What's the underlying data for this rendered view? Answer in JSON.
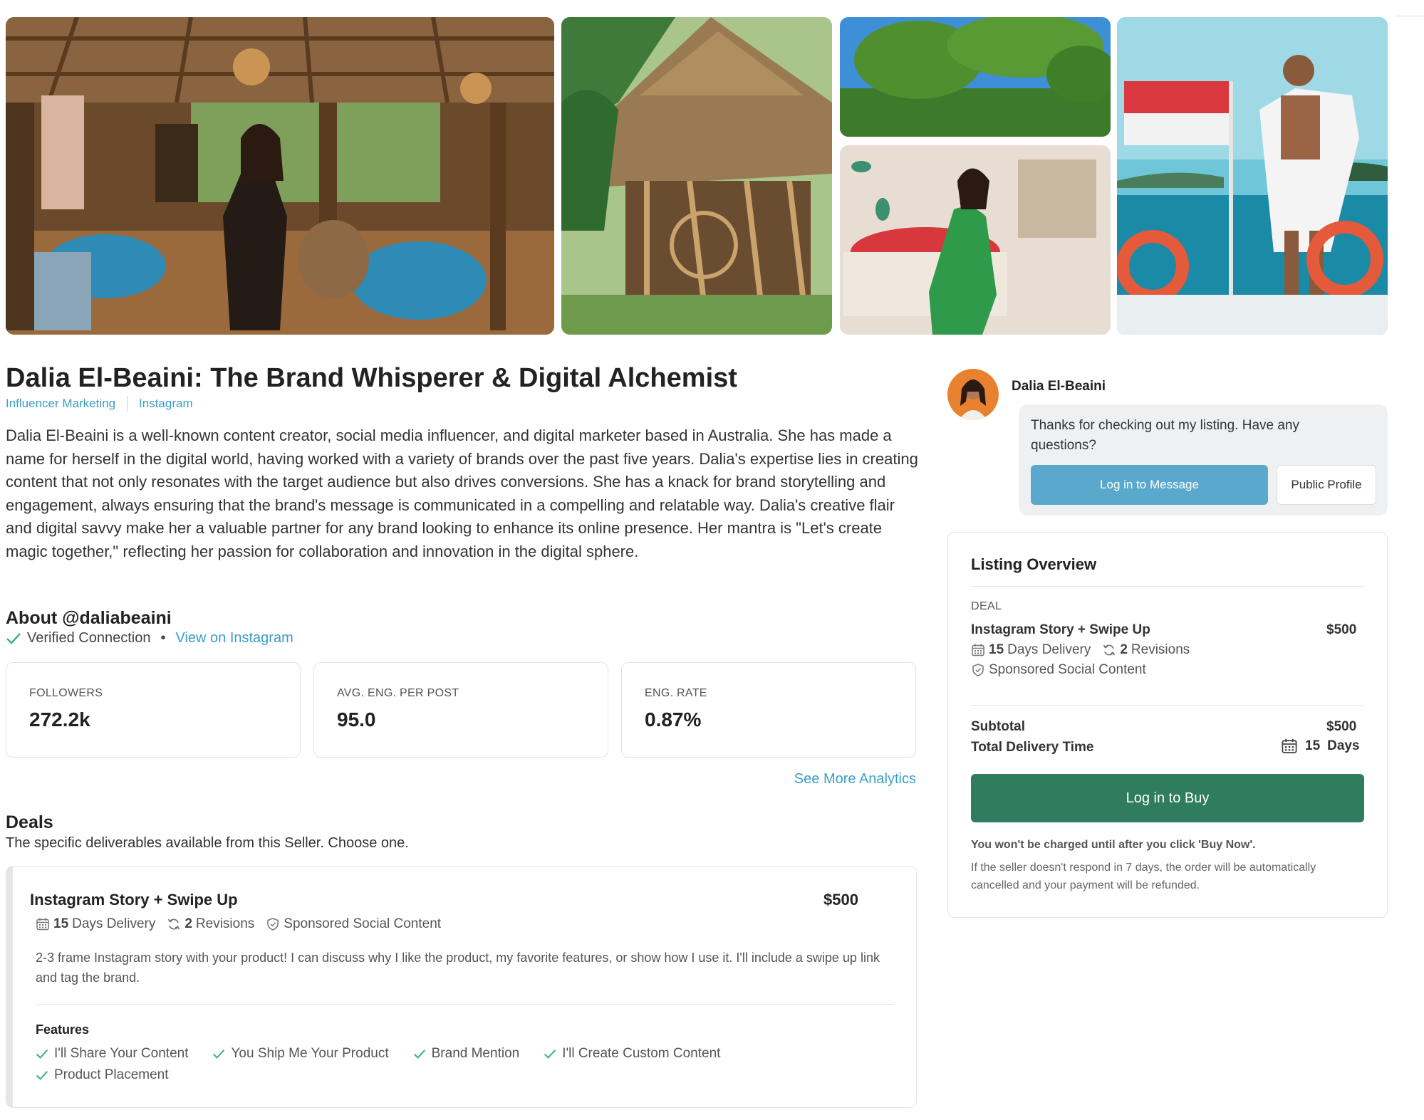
{
  "listing": {
    "title": "Dalia El-Beaini: The Brand Whisperer & Digital Alchemist",
    "tags": [
      "Influencer Marketing",
      "Instagram"
    ],
    "description": "Dalia El-Beaini is a well-known content creator, social media influencer, and digital marketer based in Australia. She has made a name for herself in the digital world, having worked with a variety of brands over the past five years. Dalia's expertise lies in creating content that not only resonates with the target audience but also drives conversions. She has a knack for brand storytelling and engagement, always ensuring that the brand's message is communicated in a compelling and relatable way. Dalia's creative flair and digital savvy make her a valuable partner for any brand looking to enhance its online presence. Her mantra is \"Let's create magic together,\" reflecting her passion for collaboration and innovation in the digital sphere."
  },
  "about": {
    "heading": "About @daliabeaini",
    "verified": "Verified Connection",
    "bullet": "•",
    "view_link": "View on Instagram"
  },
  "stats": [
    {
      "label": "FOLLOWERS",
      "value": "272.2k"
    },
    {
      "label": "AVG. ENG. PER POST",
      "value": "95.0"
    },
    {
      "label": "ENG. RATE",
      "value": "0.87%"
    }
  ],
  "see_more": "See More Analytics",
  "deals": {
    "heading": "Deals",
    "subtitle": "The specific deliverables available from this Seller. Choose one.",
    "item": {
      "name": "Instagram Story + Swipe Up",
      "price": "$500",
      "delivery_num": "15",
      "delivery_text": "Days Delivery",
      "revisions_num": "2",
      "revisions_text": "Revisions",
      "type": "Sponsored Social Content",
      "description": "2-3 frame Instagram story with your product! I can discuss why I like the product, my favorite features, or show how I use it. I'll include a swipe up link and tag the brand.",
      "features_heading": "Features",
      "features": [
        "I'll Share Your Content",
        "You Ship Me Your Product",
        "Brand Mention",
        "I'll Create Custom Content",
        "Product Placement"
      ]
    }
  },
  "seller": {
    "name": "Dalia El-Beaini",
    "message": "Thanks for checking out my listing. Have any questions?",
    "message_button": "Log in to Message",
    "profile_button": "Public Profile"
  },
  "overview": {
    "heading": "Listing Overview",
    "deal_label": "DEAL",
    "deal_name": "Instagram Story + Swipe Up",
    "deal_price": "$500",
    "delivery_num": "15",
    "delivery_text": "Days Delivery",
    "revisions_num": "2",
    "revisions_text": "Revisions",
    "type": "Sponsored Social Content",
    "subtotal_label": "Subtotal",
    "subtotal_value": "$500",
    "total_delivery_label": "Total Delivery Time",
    "total_delivery_num": "15",
    "total_delivery_unit": "Days",
    "buy_button": "Log in to Buy",
    "note_bold": "You won't be charged until after you click 'Buy Now'.",
    "note": "If the seller doesn't respond in 7 days, the order will be automatically cancelled and your payment will be refunded."
  },
  "colors": {
    "link": "#3a9fc4",
    "check": "#3bb08f",
    "buy_button": "#2f7d5e",
    "message_button": "#5aa8cc"
  }
}
